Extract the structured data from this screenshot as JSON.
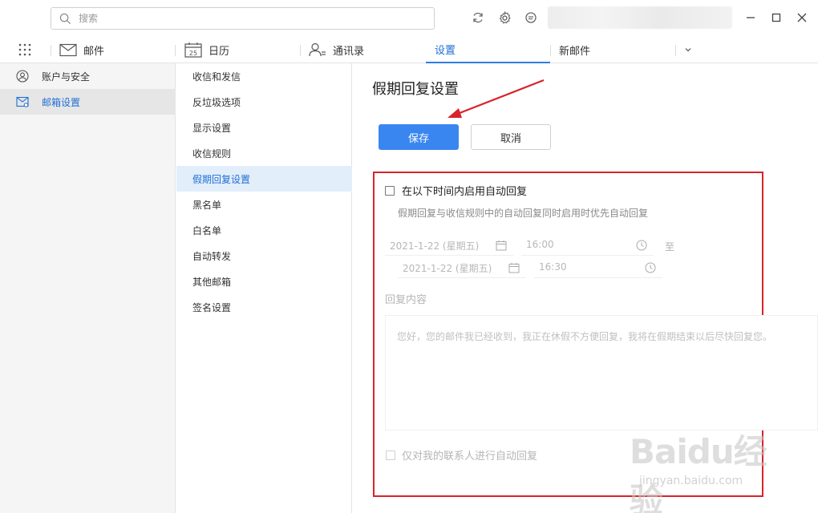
{
  "titlebar": {
    "search_placeholder": "搜索",
    "icons": [
      "sync-icon",
      "gear-icon",
      "message-icon"
    ],
    "window_buttons": [
      "minimize-icon",
      "maximize-icon",
      "close-icon"
    ]
  },
  "tabs": {
    "items": [
      {
        "label": "邮件",
        "icon": "mail-icon"
      },
      {
        "label": "日历",
        "icon": "calendar-icon",
        "icon_text": "25"
      },
      {
        "label": "通讯录",
        "icon": "contacts-icon"
      },
      {
        "label": "设置",
        "active": true
      },
      {
        "label": "新邮件"
      }
    ]
  },
  "sidebar": {
    "items": [
      {
        "label": "账户与安全",
        "icon": "user-icon"
      },
      {
        "label": "邮箱设置",
        "icon": "mail-settings-icon",
        "active": true
      }
    ]
  },
  "subnav": {
    "items": [
      {
        "label": "收信和发信"
      },
      {
        "label": "反垃圾选项"
      },
      {
        "label": "显示设置"
      },
      {
        "label": "收信规则"
      },
      {
        "label": "假期回复设置",
        "active": true
      },
      {
        "label": "黑名单"
      },
      {
        "label": "白名单"
      },
      {
        "label": "自动转发"
      },
      {
        "label": "其他邮箱"
      },
      {
        "label": "签名设置"
      }
    ]
  },
  "main": {
    "title": "假期回复设置",
    "save_label": "保存",
    "cancel_label": "取消",
    "enable_label": "在以下时间内启用自动回复",
    "hint": "假期回复与收信规则中的自动回复同时启用时优先自动回复",
    "start_date": "2021-1-22 (星期五)",
    "start_time": "16:00",
    "to_label": "至",
    "end_date": "2021-1-22 (星期五)",
    "end_time": "16:30",
    "content_label": "回复内容",
    "reply_text": "您好，您的邮件我已经收到，我正在休假不方便回复，我将在假期结束以后尽快回复您。",
    "contacts_only_label": "仅对我的联系人进行自动回复"
  },
  "colors": {
    "accent": "#3a86f0",
    "annotation": "#d8232a",
    "active_link": "#1f6fd6"
  },
  "watermark": {
    "brand": "Baidu经验",
    "url": "jingyan.baidu.com"
  }
}
